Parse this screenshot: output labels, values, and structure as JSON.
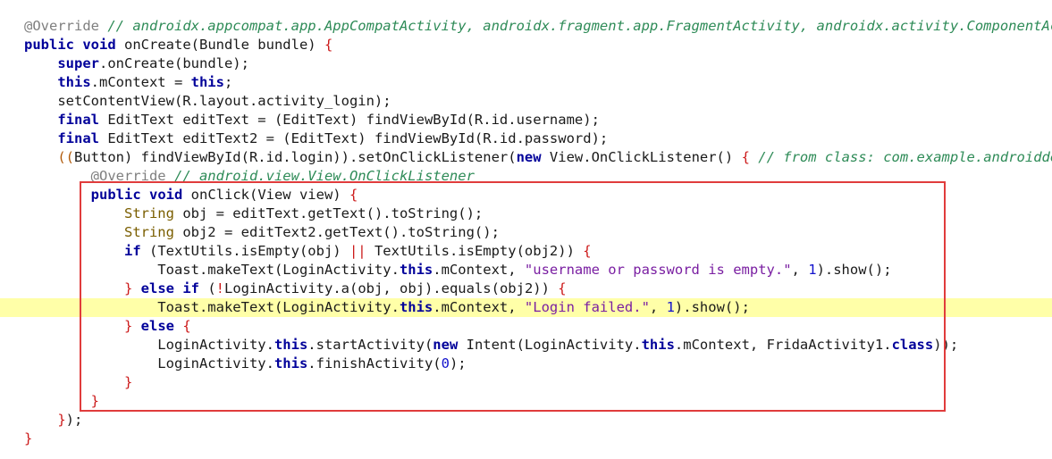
{
  "editor": {
    "highlighted_line": 15,
    "lines": [
      [
        [
          "ann",
          "@Override "
        ],
        [
          "cm",
          "// androidx.appcompat.app.AppCompatActivity, androidx.fragment.app.FragmentActivity, androidx.activity.ComponentActivity"
        ]
      ],
      [
        [
          "kw",
          "public"
        ],
        [
          "pl",
          " "
        ],
        [
          "kw",
          "void"
        ],
        [
          "pl",
          " onCreate(Bundle bundle) "
        ],
        [
          "red",
          "{"
        ]
      ],
      [
        [
          "pl",
          "    "
        ],
        [
          "kw",
          "super"
        ],
        [
          "pl",
          ".onCreate(bundle);"
        ]
      ],
      [
        [
          "pl",
          "    "
        ],
        [
          "kw",
          "this"
        ],
        [
          "pl",
          ".mContext = "
        ],
        [
          "kw",
          "this"
        ],
        [
          "pl",
          ";"
        ]
      ],
      [
        [
          "pl",
          "    setContentView(R.layout.activity_login);"
        ]
      ],
      [
        [
          "pl",
          "    "
        ],
        [
          "kw",
          "final"
        ],
        [
          "pl",
          " EditText editText = (EditText) findViewById(R.id.username);"
        ]
      ],
      [
        [
          "pl",
          "    "
        ],
        [
          "kw",
          "final"
        ],
        [
          "pl",
          " EditText editText2 = (EditText) findViewById(R.id.password);"
        ]
      ],
      [
        [
          "par",
          "    (("
        ],
        [
          "pl",
          "Button) findViewById(R.id.login)).setOnClickListener("
        ],
        [
          "kw",
          "new"
        ],
        [
          "pl",
          " View.OnClickListener() "
        ],
        [
          "red",
          "{"
        ],
        [
          "pl",
          " "
        ],
        [
          "cm",
          "// from class: com.example.androiddemo.Activity.LoginActivity"
        ]
      ],
      [
        [
          "pl",
          "        "
        ],
        [
          "ann",
          "@Override "
        ],
        [
          "cm",
          "// android.view.View.OnClickListener"
        ]
      ],
      [
        [
          "pl",
          "        "
        ],
        [
          "kw",
          "public"
        ],
        [
          "pl",
          " "
        ],
        [
          "kw",
          "void"
        ],
        [
          "pl",
          " onClick(View view) "
        ],
        [
          "red",
          "{"
        ]
      ],
      [
        [
          "pl",
          "            "
        ],
        [
          "ty",
          "String"
        ],
        [
          "pl",
          " obj = editText.getText().toString();"
        ]
      ],
      [
        [
          "pl",
          "            "
        ],
        [
          "ty",
          "String"
        ],
        [
          "pl",
          " obj2 = editText2.getText().toString();"
        ]
      ],
      [
        [
          "pl",
          "            "
        ],
        [
          "kw",
          "if"
        ],
        [
          "pl",
          " (TextUtils.isEmpty(obj) "
        ],
        [
          "red",
          "||"
        ],
        [
          "pl",
          " TextUtils.isEmpty(obj2)) "
        ],
        [
          "red",
          "{"
        ]
      ],
      [
        [
          "pl",
          "                Toast.makeText(LoginActivity."
        ],
        [
          "kw",
          "this"
        ],
        [
          "pl",
          ".mContext, "
        ],
        [
          "str",
          "\"username or password is empty.\""
        ],
        [
          "pl",
          ", "
        ],
        [
          "num",
          "1"
        ],
        [
          "pl",
          ").show();"
        ]
      ],
      [
        [
          "pl",
          "            "
        ],
        [
          "red",
          "}"
        ],
        [
          "pl",
          " "
        ],
        [
          "kw",
          "else if"
        ],
        [
          "pl",
          " ("
        ],
        [
          "red",
          "!"
        ],
        [
          "pl",
          "LoginActivity.a(obj, obj).equals(obj2)) "
        ],
        [
          "red",
          "{"
        ]
      ],
      [
        [
          "pl",
          "                Toast.makeText(LoginActivity."
        ],
        [
          "kw",
          "this"
        ],
        [
          "pl",
          ".mContext, "
        ],
        [
          "str",
          "\"Login failed.\""
        ],
        [
          "pl",
          ", "
        ],
        [
          "num",
          "1"
        ],
        [
          "pl",
          ").show();"
        ]
      ],
      [
        [
          "pl",
          "            "
        ],
        [
          "red",
          "}"
        ],
        [
          "pl",
          " "
        ],
        [
          "kw",
          "else"
        ],
        [
          "pl",
          " "
        ],
        [
          "red",
          "{"
        ]
      ],
      [
        [
          "pl",
          "                LoginActivity."
        ],
        [
          "kw",
          "this"
        ],
        [
          "pl",
          ".startActivity("
        ],
        [
          "kw",
          "new"
        ],
        [
          "pl",
          " Intent(LoginActivity."
        ],
        [
          "kw",
          "this"
        ],
        [
          "pl",
          ".mContext, FridaActivity1."
        ],
        [
          "kw",
          "class"
        ],
        [
          "pl",
          "));"
        ]
      ],
      [
        [
          "pl",
          "                LoginActivity."
        ],
        [
          "kw",
          "this"
        ],
        [
          "pl",
          ".finishActivity("
        ],
        [
          "num",
          "0"
        ],
        [
          "pl",
          ");"
        ]
      ],
      [
        [
          "pl",
          "            "
        ],
        [
          "red",
          "}"
        ]
      ],
      [
        [
          "pl",
          "        "
        ],
        [
          "red",
          "}"
        ]
      ],
      [
        [
          "pl",
          "    "
        ],
        [
          "red",
          "}"
        ],
        [
          "pl",
          ");"
        ]
      ],
      [
        [
          "red",
          "}"
        ]
      ]
    ]
  },
  "colors": {
    "keyword": "#00009a",
    "annotation": "#7f7f7f",
    "comment": "#2e8b57",
    "string": "#7a1fa2",
    "number": "#1212cc",
    "brace": "#cc1a1a",
    "highlight_line": "#ffffa8",
    "box_border": "#e03c3c"
  }
}
